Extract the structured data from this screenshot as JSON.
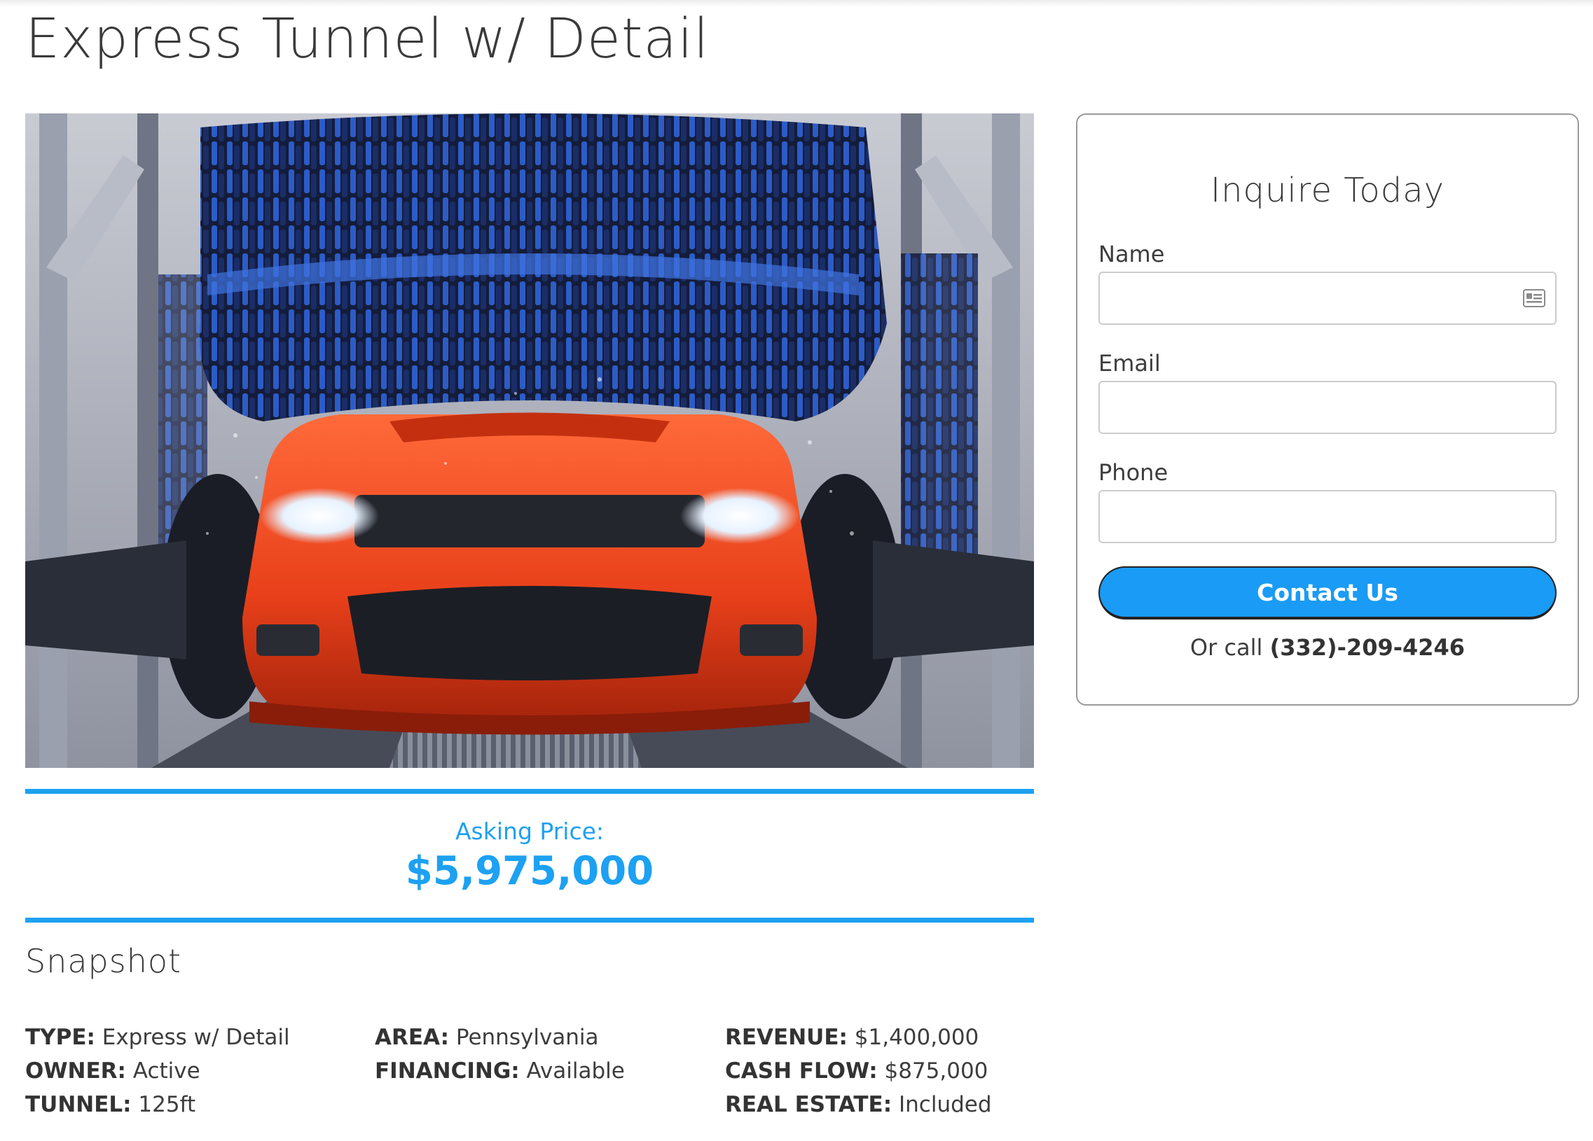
{
  "page": {
    "title": "Express Tunnel w/ Detail"
  },
  "hero": {
    "alt": "Orange car in express car wash tunnel with blue brushes"
  },
  "pricing": {
    "label": "Asking Price:",
    "value": "$5,975,000"
  },
  "snapshot": {
    "title": "Snapshot",
    "columns": [
      [
        {
          "key": "TYPE:",
          "value": "Express w/ Detail"
        },
        {
          "key": "OWNER:",
          "value": "Active"
        },
        {
          "key": "TUNNEL:",
          "value": "125ft"
        }
      ],
      [
        {
          "key": "AREA:",
          "value": "Pennsylvania"
        },
        {
          "key": "FINANCING:",
          "value": "Available"
        }
      ],
      [
        {
          "key": "REVENUE:",
          "value": "$1,400,000"
        },
        {
          "key": "CASH FLOW:",
          "value": "$875,000"
        },
        {
          "key": "REAL ESTATE:",
          "value": "Included"
        }
      ]
    ]
  },
  "form": {
    "title": "Inquire Today",
    "fields": [
      {
        "label": "Name",
        "value": "",
        "placeholder": ""
      },
      {
        "label": "Email",
        "value": "",
        "placeholder": ""
      },
      {
        "label": "Phone",
        "value": "",
        "placeholder": ""
      }
    ],
    "submit_label": "Contact Us",
    "call_prefix": "Or call ",
    "phone_number": "(332)-209-4246",
    "autofill_icon": "contact-card-icon"
  },
  "colors": {
    "accent": "#1da1f2",
    "button": "#1a9bf5",
    "text": "#333333"
  }
}
